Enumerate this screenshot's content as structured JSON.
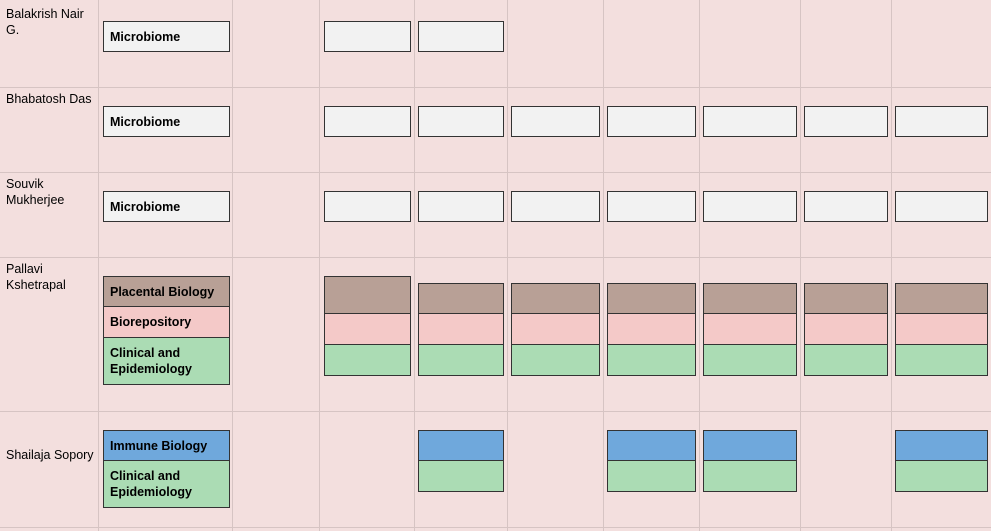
{
  "colors": {
    "grid_bg": "#f3dfde",
    "grid_line": "#d6c4c3",
    "microbiome": "#f2f2f2",
    "placental": "#b8a096",
    "biorepository": "#f4c9c8",
    "clinical": "#abdcb4",
    "immune": "#6fa8dc"
  },
  "rows": [
    {
      "name": "Balakrish Nair G.",
      "labels": [
        {
          "text": "Microbiome",
          "kind": "microbiome"
        }
      ],
      "columns_filled": [
        true,
        true,
        false,
        false,
        false,
        false,
        false
      ]
    },
    {
      "name": "Bhabatosh Das",
      "labels": [
        {
          "text": "Microbiome",
          "kind": "microbiome"
        }
      ],
      "columns_filled": [
        true,
        true,
        true,
        true,
        true,
        true,
        true
      ]
    },
    {
      "name": "Souvik Mukherjee",
      "labels": [
        {
          "text": "Microbiome",
          "kind": "microbiome"
        }
      ],
      "columns_filled": [
        true,
        true,
        true,
        true,
        true,
        true,
        true
      ]
    },
    {
      "name": "Pallavi Kshetrapal",
      "labels": [
        {
          "text": "Placental Biology",
          "kind": "placental"
        },
        {
          "text": "Biorepository",
          "kind": "biorepository"
        },
        {
          "text": "Clinical and Epidemiology",
          "kind": "clinical"
        }
      ],
      "columns_filled": [
        true,
        true,
        true,
        true,
        true,
        true,
        true
      ]
    },
    {
      "name": "Shailaja Sopory",
      "labels": [
        {
          "text": "Immune Biology",
          "kind": "immune"
        },
        {
          "text": "Clinical and Epidemiology",
          "kind": "clinical"
        }
      ],
      "columns_filled": [
        false,
        true,
        false,
        true,
        true,
        false,
        true
      ]
    }
  ]
}
